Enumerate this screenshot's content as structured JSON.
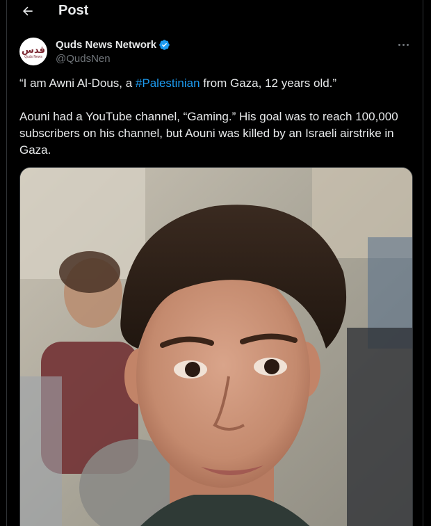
{
  "header": {
    "title": "Post",
    "back_icon": "arrow-left-icon"
  },
  "author": {
    "name": "Quds News Network",
    "handle": "@QudsNen",
    "verified": true,
    "avatar_logo_ar": "قدس",
    "avatar_logo_en": "Quds News"
  },
  "tweet": {
    "line1_before": "“I am Awni Al-Dous, a ",
    "line1_hashtag": "#Palestinian",
    "line1_after": " from Gaza, 12 years old.”",
    "paragraph2": "Aouni had a YouTube channel, “Gaming.” His goal was to reach 100,000 subscribers on his channel, but Aouni was killed by an Israeli airstrike in Gaza."
  },
  "media": {
    "type": "photo"
  },
  "colors": {
    "background": "#000000",
    "text_primary": "#e7e9ea",
    "text_secondary": "#71767b",
    "accent": "#1d9bf0",
    "border": "#2f3336"
  }
}
